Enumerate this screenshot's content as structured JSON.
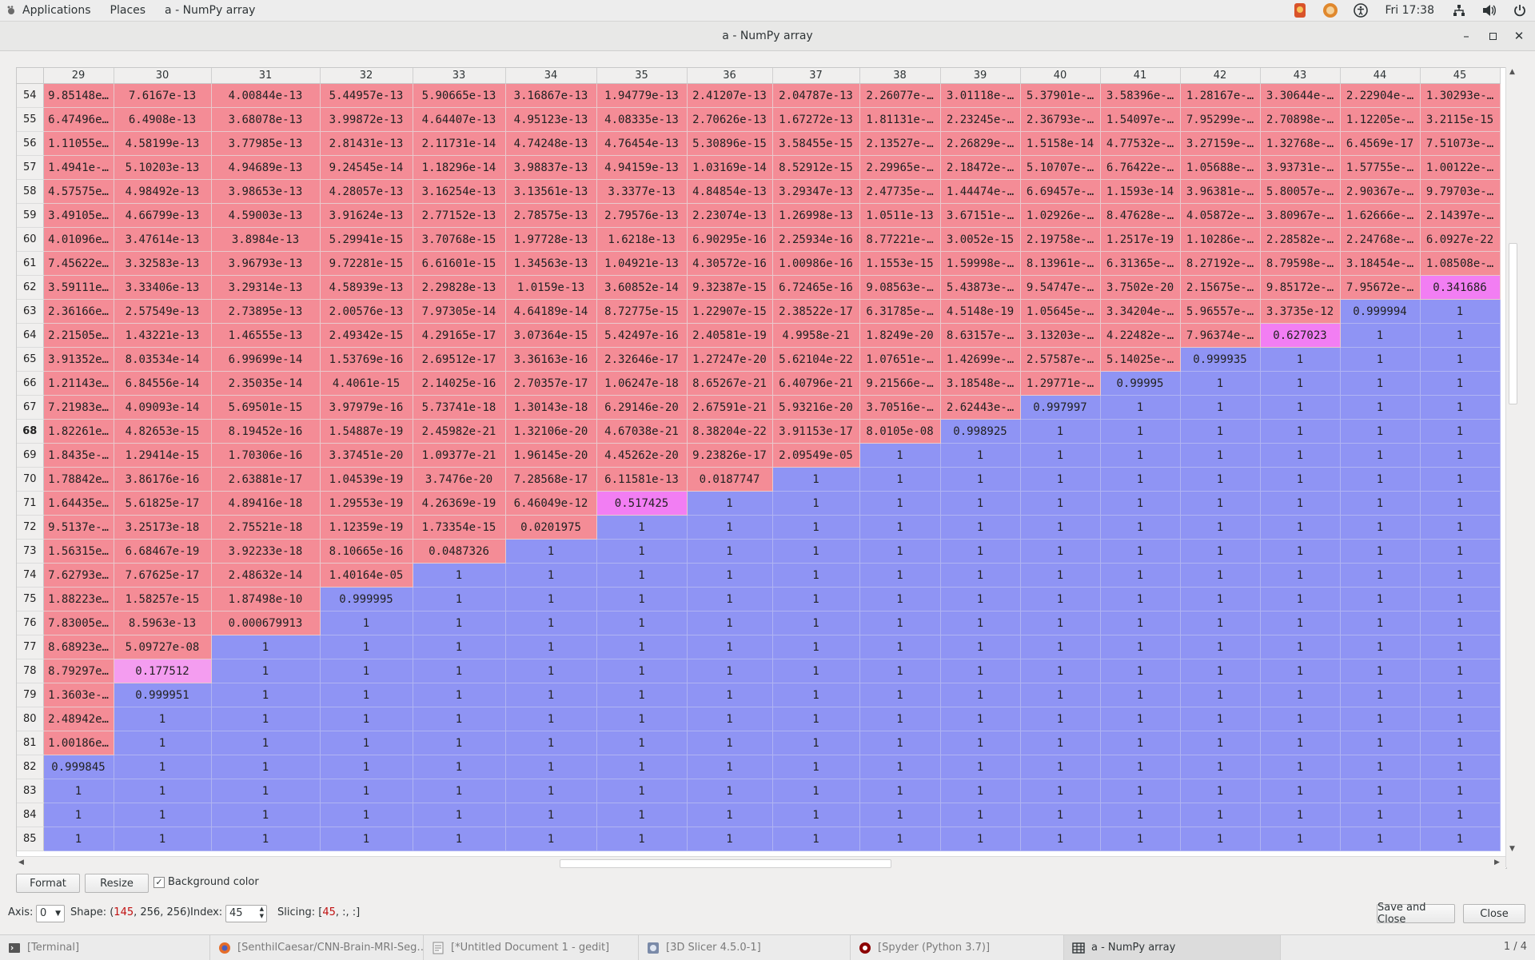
{
  "top_panel": {
    "applications": "Applications",
    "places": "Places",
    "active_app": "a - NumPy array",
    "clock": "Fri 17:38"
  },
  "window": {
    "title": "a - NumPy array"
  },
  "table": {
    "col_headers": [
      "29",
      "30",
      "31",
      "32",
      "33",
      "34",
      "35",
      "36",
      "37",
      "38",
      "39",
      "40",
      "41",
      "42",
      "43",
      "44",
      "45"
    ],
    "current_row": "68",
    "rows": [
      {
        "idx": "54",
        "cells": [
          "9.85148e…",
          "7.6167e-13",
          "4.00844e-13",
          "5.44957e-13",
          "5.90665e-13",
          "3.16867e-13",
          "1.94779e-13",
          "2.41207e-13",
          "2.04787e-13",
          "2.26077e-…",
          "3.01118e-…",
          "5.37901e-…",
          "3.58396e-…",
          "1.28167e-…",
          "3.30644e-…",
          "2.22904e-…",
          "1.30293e-…"
        ]
      },
      {
        "idx": "55",
        "cells": [
          "6.47496e…",
          "6.4908e-13",
          "3.68078e-13",
          "3.99872e-13",
          "4.64407e-13",
          "4.95123e-13",
          "4.08335e-13",
          "2.70626e-13",
          "1.67272e-13",
          "1.81131e-…",
          "2.23245e-…",
          "2.36793e-…",
          "1.54097e-…",
          "7.95299e-…",
          "2.70898e-…",
          "1.12205e-…",
          "3.2115e-15"
        ]
      },
      {
        "idx": "56",
        "cells": [
          "1.11055e…",
          "4.58199e-13",
          "3.77985e-13",
          "2.81431e-13",
          "2.11731e-14",
          "4.74248e-13",
          "4.76454e-13",
          "5.30896e-15",
          "3.58455e-15",
          "2.13527e-…",
          "2.26829e-…",
          "1.5158e-14",
          "4.77532e-…",
          "3.27159e-…",
          "1.32768e-…",
          "6.4569e-17",
          "7.51073e-…"
        ]
      },
      {
        "idx": "57",
        "cells": [
          "1.4941e-…",
          "5.10203e-13",
          "4.94689e-13",
          "9.24545e-14",
          "1.18296e-14",
          "3.98837e-13",
          "4.94159e-13",
          "1.03169e-14",
          "8.52912e-15",
          "2.29965e-…",
          "2.18472e-…",
          "5.10707e-…",
          "6.76422e-…",
          "1.05688e-…",
          "3.93731e-…",
          "1.57755e-…",
          "1.00122e-…"
        ]
      },
      {
        "idx": "58",
        "cells": [
          "4.57575e…",
          "4.98492e-13",
          "3.98653e-13",
          "4.28057e-13",
          "3.16254e-13",
          "3.13561e-13",
          "3.3377e-13",
          "4.84854e-13",
          "3.29347e-13",
          "2.47735e-…",
          "1.44474e-…",
          "6.69457e-…",
          "1.1593e-14",
          "3.96381e-…",
          "5.80057e-…",
          "2.90367e-…",
          "9.79703e-…"
        ]
      },
      {
        "idx": "59",
        "cells": [
          "3.49105e…",
          "4.66799e-13",
          "4.59003e-13",
          "3.91624e-13",
          "2.77152e-13",
          "2.78575e-13",
          "2.79576e-13",
          "2.23074e-13",
          "1.26998e-13",
          "1.0511e-13",
          "3.67151e-…",
          "1.02926e-…",
          "8.47628e-…",
          "4.05872e-…",
          "3.80967e-…",
          "1.62666e-…",
          "2.14397e-…"
        ]
      },
      {
        "idx": "60",
        "cells": [
          "4.01096e…",
          "3.47614e-13",
          "3.8984e-13",
          "5.29941e-15",
          "3.70768e-15",
          "1.97728e-13",
          "1.6218e-13",
          "6.90295e-16",
          "2.25934e-16",
          "8.77221e-…",
          "3.0052e-15",
          "2.19758e-…",
          "1.2517e-19",
          "1.10286e-…",
          "2.28582e-…",
          "2.24768e-…",
          "6.0927e-22"
        ]
      },
      {
        "idx": "61",
        "cells": [
          "7.45622e…",
          "3.32583e-13",
          "3.96793e-13",
          "9.72281e-15",
          "6.61601e-15",
          "1.34563e-13",
          "1.04921e-13",
          "4.30572e-16",
          "1.00986e-16",
          "1.1553e-15",
          "1.59998e-…",
          "8.13961e-…",
          "6.31365e-…",
          "8.27192e-…",
          "8.79598e-…",
          "3.18454e-…",
          "1.08508e-…"
        ]
      },
      {
        "idx": "62",
        "cells": [
          "3.59111e…",
          "3.33406e-13",
          "3.29314e-13",
          "4.58939e-13",
          "2.29828e-13",
          "1.0159e-13",
          "3.60852e-14",
          "9.32387e-15",
          "6.72465e-16",
          "9.08563e-…",
          "5.43873e-…",
          "9.54747e-…",
          "3.7502e-20",
          "2.15675e-…",
          "9.85172e-…",
          "7.95672e-…",
          "0.341686"
        ]
      },
      {
        "idx": "63",
        "cells": [
          "2.36166e…",
          "2.57549e-13",
          "2.73895e-13",
          "2.00576e-13",
          "7.97305e-14",
          "4.64189e-14",
          "8.72775e-15",
          "1.22907e-15",
          "2.38522e-17",
          "6.31785e-…",
          "4.5148e-19",
          "1.05645e-…",
          "3.34204e-…",
          "5.96557e-…",
          "3.3735e-12",
          "0.999994",
          "1"
        ]
      },
      {
        "idx": "64",
        "cells": [
          "2.21505e…",
          "1.43221e-13",
          "1.46555e-13",
          "2.49342e-15",
          "4.29165e-17",
          "3.07364e-15",
          "5.42497e-16",
          "2.40581e-19",
          "4.9958e-21",
          "1.8249e-20",
          "8.63157e-…",
          "3.13203e-…",
          "4.22482e-…",
          "7.96374e-…",
          "0.627023",
          "1",
          "1"
        ]
      },
      {
        "idx": "65",
        "cells": [
          "3.91352e…",
          "8.03534e-14",
          "6.99699e-14",
          "1.53769e-16",
          "2.69512e-17",
          "3.36163e-16",
          "2.32646e-17",
          "1.27247e-20",
          "5.62104e-22",
          "1.07651e-…",
          "1.42699e-…",
          "2.57587e-…",
          "5.14025e-…",
          "0.999935",
          "1",
          "1",
          "1"
        ]
      },
      {
        "idx": "66",
        "cells": [
          "1.21143e…",
          "6.84556e-14",
          "2.35035e-14",
          "4.4061e-15",
          "2.14025e-16",
          "2.70357e-17",
          "1.06247e-18",
          "8.65267e-21",
          "6.40796e-21",
          "9.21566e-…",
          "3.18548e-…",
          "1.29771e-…",
          "0.99995",
          "1",
          "1",
          "1",
          "1"
        ]
      },
      {
        "idx": "67",
        "cells": [
          "7.21983e…",
          "4.09093e-14",
          "5.69501e-15",
          "3.97979e-16",
          "5.73741e-18",
          "1.30143e-18",
          "6.29146e-20",
          "2.67591e-21",
          "5.93216e-20",
          "3.70516e-…",
          "2.62443e-…",
          "0.997997",
          "1",
          "1",
          "1",
          "1",
          "1"
        ]
      },
      {
        "idx": "68",
        "cells": [
          "1.82261e…",
          "4.82653e-15",
          "8.19452e-16",
          "1.54887e-19",
          "2.45982e-21",
          "1.32106e-20",
          "4.67038e-21",
          "8.38204e-22",
          "3.91153e-17",
          "8.0105e-08",
          "0.998925",
          "1",
          "1",
          "1",
          "1",
          "1",
          "1"
        ]
      },
      {
        "idx": "69",
        "cells": [
          "1.8435e-…",
          "1.29414e-15",
          "1.70306e-16",
          "3.37451e-20",
          "1.09377e-21",
          "1.96145e-20",
          "4.45262e-20",
          "9.23826e-17",
          "2.09549e-05",
          "1",
          "1",
          "1",
          "1",
          "1",
          "1",
          "1",
          "1"
        ]
      },
      {
        "idx": "70",
        "cells": [
          "1.78842e…",
          "3.86176e-16",
          "2.63881e-17",
          "1.04539e-19",
          "3.7476e-20",
          "7.28568e-17",
          "6.11581e-13",
          "0.0187747",
          "1",
          "1",
          "1",
          "1",
          "1",
          "1",
          "1",
          "1",
          "1"
        ]
      },
      {
        "idx": "71",
        "cells": [
          "1.64435e…",
          "5.61825e-17",
          "4.89416e-18",
          "1.29553e-19",
          "4.26369e-19",
          "6.46049e-12",
          "0.517425",
          "1",
          "1",
          "1",
          "1",
          "1",
          "1",
          "1",
          "1",
          "1",
          "1"
        ]
      },
      {
        "idx": "72",
        "cells": [
          "9.5137e-…",
          "3.25173e-18",
          "2.75521e-18",
          "1.12359e-19",
          "1.73354e-15",
          "0.0201975",
          "1",
          "1",
          "1",
          "1",
          "1",
          "1",
          "1",
          "1",
          "1",
          "1",
          "1"
        ]
      },
      {
        "idx": "73",
        "cells": [
          "1.56315e…",
          "6.68467e-19",
          "3.92233e-18",
          "8.10665e-16",
          "0.0487326",
          "1",
          "1",
          "1",
          "1",
          "1",
          "1",
          "1",
          "1",
          "1",
          "1",
          "1",
          "1"
        ]
      },
      {
        "idx": "74",
        "cells": [
          "7.62793e…",
          "7.67625e-17",
          "2.48632e-14",
          "1.40164e-05",
          "1",
          "1",
          "1",
          "1",
          "1",
          "1",
          "1",
          "1",
          "1",
          "1",
          "1",
          "1",
          "1"
        ]
      },
      {
        "idx": "75",
        "cells": [
          "1.88223e…",
          "1.58257e-15",
          "1.87498e-10",
          "0.999995",
          "1",
          "1",
          "1",
          "1",
          "1",
          "1",
          "1",
          "1",
          "1",
          "1",
          "1",
          "1",
          "1"
        ]
      },
      {
        "idx": "76",
        "cells": [
          "7.83005e…",
          "8.5963e-13",
          "0.000679913",
          "1",
          "1",
          "1",
          "1",
          "1",
          "1",
          "1",
          "1",
          "1",
          "1",
          "1",
          "1",
          "1",
          "1"
        ]
      },
      {
        "idx": "77",
        "cells": [
          "8.68923e…",
          "5.09727e-08",
          "1",
          "1",
          "1",
          "1",
          "1",
          "1",
          "1",
          "1",
          "1",
          "1",
          "1",
          "1",
          "1",
          "1",
          "1"
        ]
      },
      {
        "idx": "78",
        "cells": [
          "8.79297e…",
          "0.177512",
          "1",
          "1",
          "1",
          "1",
          "1",
          "1",
          "1",
          "1",
          "1",
          "1",
          "1",
          "1",
          "1",
          "1",
          "1"
        ]
      },
      {
        "idx": "79",
        "cells": [
          "1.3603e-…",
          "0.999951",
          "1",
          "1",
          "1",
          "1",
          "1",
          "1",
          "1",
          "1",
          "1",
          "1",
          "1",
          "1",
          "1",
          "1",
          "1"
        ]
      },
      {
        "idx": "80",
        "cells": [
          "2.48942e…",
          "1",
          "1",
          "1",
          "1",
          "1",
          "1",
          "1",
          "1",
          "1",
          "1",
          "1",
          "1",
          "1",
          "1",
          "1",
          "1"
        ]
      },
      {
        "idx": "81",
        "cells": [
          "1.00186e…",
          "1",
          "1",
          "1",
          "1",
          "1",
          "1",
          "1",
          "1",
          "1",
          "1",
          "1",
          "1",
          "1",
          "1",
          "1",
          "1"
        ]
      },
      {
        "idx": "82",
        "cells": [
          "0.999845",
          "1",
          "1",
          "1",
          "1",
          "1",
          "1",
          "1",
          "1",
          "1",
          "1",
          "1",
          "1",
          "1",
          "1",
          "1",
          "1"
        ]
      },
      {
        "idx": "83",
        "cells": [
          "1",
          "1",
          "1",
          "1",
          "1",
          "1",
          "1",
          "1",
          "1",
          "1",
          "1",
          "1",
          "1",
          "1",
          "1",
          "1",
          "1"
        ]
      },
      {
        "idx": "84",
        "cells": [
          "1",
          "1",
          "1",
          "1",
          "1",
          "1",
          "1",
          "1",
          "1",
          "1",
          "1",
          "1",
          "1",
          "1",
          "1",
          "1",
          "1"
        ]
      },
      {
        "idx": "85",
        "cells": [
          "1",
          "1",
          "1",
          "1",
          "1",
          "1",
          "1",
          "1",
          "1",
          "1",
          "1",
          "1",
          "1",
          "1",
          "1",
          "1",
          "1"
        ]
      }
    ]
  },
  "controls": {
    "format_label": "Format",
    "resize_label": "Resize",
    "bgcolor_label": "Background color",
    "bgcolor_checked": "✓",
    "axis_label": "Axis:",
    "axis_value": "0",
    "shape_label": "Shape: (",
    "shape_a": "145",
    "shape_rest": ", 256, 256)",
    "index_label": "Index:",
    "index_value": "45",
    "slicing_label": "Slicing: [",
    "slicing_idx": "45",
    "slicing_rest": ", :, :]",
    "save_close_label": "Save and Close",
    "close_label": "Close"
  },
  "taskbar": {
    "items": [
      {
        "label": "[Terminal]"
      },
      {
        "label": "[SenthilCaesar/CNN-Brain-MRI-Seg…"
      },
      {
        "label": "[*Untitled Document 1 - gedit]"
      },
      {
        "label": "[3D Slicer 4.5.0-1]"
      },
      {
        "label": "[Spyder (Python 3.7)]"
      },
      {
        "label": "a - NumPy array"
      }
    ],
    "pager": "1 / 4"
  },
  "colors": {
    "low_value": "#f48c96",
    "high_value": "#8f94f4",
    "mid_value": "#f27ef3"
  }
}
